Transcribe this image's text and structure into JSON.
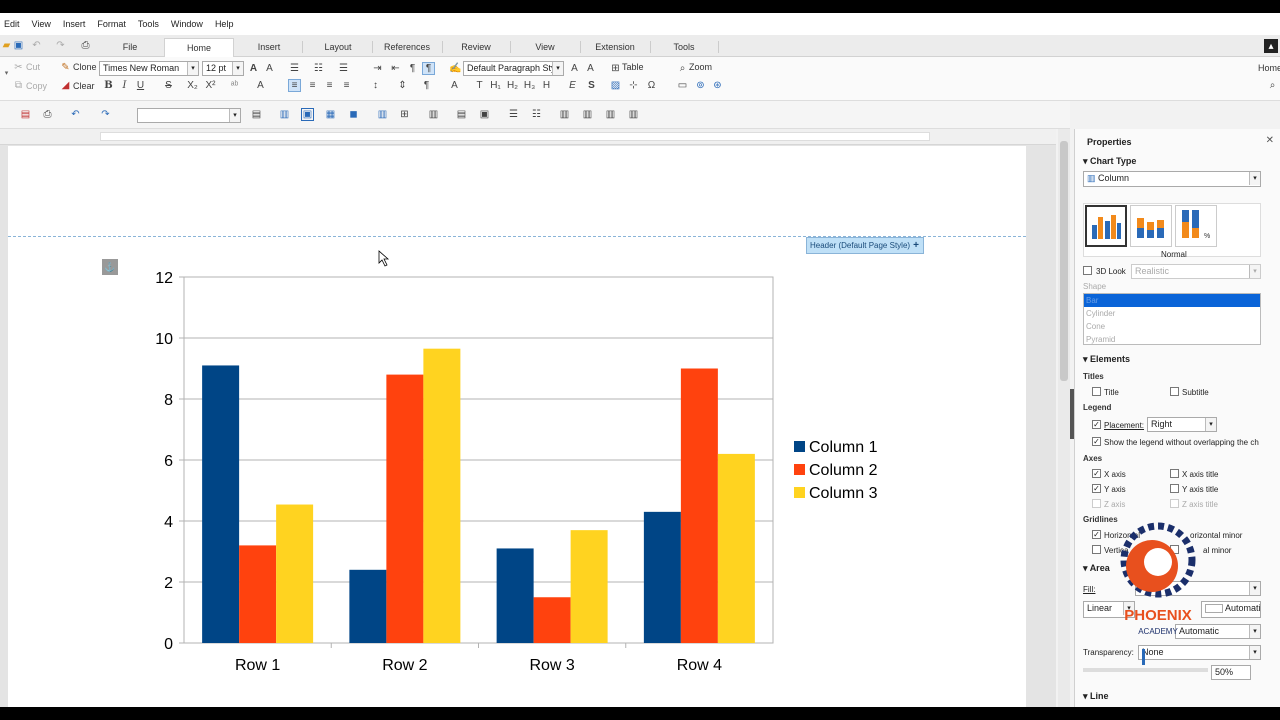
{
  "menu": [
    "Edit",
    "View",
    "Insert",
    "Format",
    "Tools",
    "Window",
    "Help"
  ],
  "tabs": [
    "File",
    "Home",
    "Insert",
    "Layout",
    "References",
    "Review",
    "View",
    "Extension",
    "Tools"
  ],
  "toolbar": {
    "cut": "Cut",
    "copy": "Copy",
    "clone": "Clone",
    "clear": "Clear",
    "font_name": "Times New Roman",
    "font_size": "12 pt",
    "para_style": "Default Paragraph Style",
    "table": "Table",
    "zoom": "Zoom",
    "right_label": "Home"
  },
  "header_tag": "Header (Default Page Style)",
  "sidebar": {
    "title": "Properties",
    "chart_type": "Chart Type",
    "chart_type_value": "Column",
    "preset_label": "Normal",
    "look_3d": "3D Look",
    "look_3d_value": "Realistic",
    "shape": "Shape",
    "shapes": [
      "Bar",
      "Cylinder",
      "Cone",
      "Pyramid"
    ],
    "elements": "Elements",
    "titles": "Titles",
    "title_chk": "Title",
    "subtitle_chk": "Subtitle",
    "legend": "Legend",
    "placement": "Placement:",
    "placement_value": "Right",
    "legend_overlap": "Show the legend without overlapping the ch",
    "axes": "Axes",
    "x_axis": "X axis",
    "x_axis_title": "X axis title",
    "y_axis": "Y axis",
    "y_axis_title": "Y axis title",
    "z_axis": "Z axis",
    "z_axis_title": "Z axis title",
    "gridlines": "Gridlines",
    "horiz_major": "Horizontal",
    "horiz_minor": "orizontal minor",
    "vert_major": "Vertica",
    "vert_minor": "al minor",
    "area": "Area",
    "fill": "Fill:",
    "fill_type": "Linear",
    "automatic": "Automati",
    "automatic2": "Automatic",
    "transparency": "Transparency:",
    "transparency_value": "None",
    "percent": "50%",
    "line": "Line"
  },
  "watermark": {
    "name": "PHOENIX",
    "sub": "ACADEMY"
  },
  "chart_data": {
    "type": "bar",
    "categories": [
      "Row 1",
      "Row 2",
      "Row 3",
      "Row 4"
    ],
    "series": [
      {
        "name": "Column 1",
        "values": [
          9.1,
          2.4,
          3.1,
          4.3
        ],
        "color": "#004586"
      },
      {
        "name": "Column 2",
        "values": [
          3.2,
          8.8,
          1.5,
          9.0
        ],
        "color": "#ff420e"
      },
      {
        "name": "Column 3",
        "values": [
          4.54,
          9.65,
          3.7,
          6.2
        ],
        "color": "#ffd320"
      }
    ],
    "ylim": [
      0,
      12
    ],
    "yticks": [
      "0",
      "2",
      "4",
      "6",
      "8",
      "10",
      "12"
    ],
    "grid": true,
    "legend": "right"
  }
}
